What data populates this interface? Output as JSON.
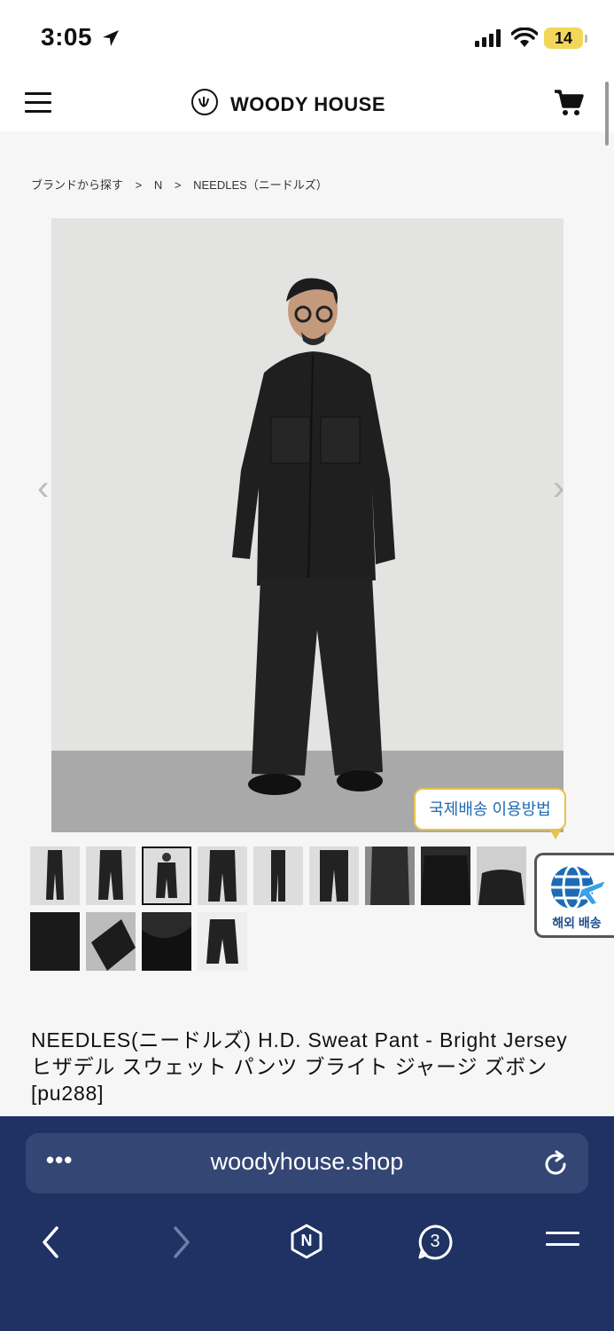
{
  "status_bar": {
    "time": "3:05",
    "battery": "14",
    "battery_color": "#f2d75a"
  },
  "header": {
    "logo_text": "WOODY HOUSE",
    "menu_icon": "hamburger-menu-icon",
    "cart_icon": "shopping-cart-icon"
  },
  "breadcrumb": [
    "ブランドから探す",
    ">",
    "N",
    ">",
    "NEEDLES（ニードルズ）"
  ],
  "gallery": {
    "prev_arrow": "‹",
    "next_arrow": "›",
    "selected_thumbnail": 3
  },
  "shipping": {
    "tooltip": "국제배송 이용방법",
    "badge_label": "해외 배송",
    "accent_color": "#e7c24b"
  },
  "product": {
    "title": "NEEDLES(ニードルズ) H.D. Sweat Pant - Bright Jersey ヒザデル スウェット パンツ ブライト ジャージ ズボン [pu288]"
  },
  "browser": {
    "url": "woodyhouse.shop",
    "more": "•••",
    "tabs_count": "3",
    "home_letter": "N",
    "bar_color": "#1f3263"
  }
}
